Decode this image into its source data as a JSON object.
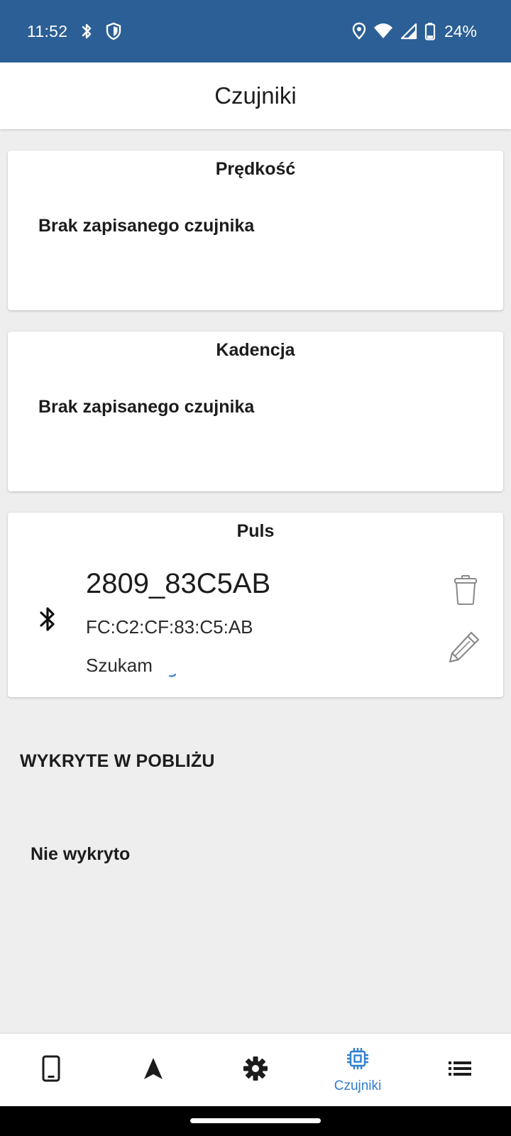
{
  "status_bar": {
    "time": "11:52",
    "battery_text": "24%",
    "icons_left": [
      "bluetooth-icon",
      "shield-icon"
    ],
    "icons_right": [
      "location-icon",
      "wifi-icon",
      "signal-icon",
      "battery-icon"
    ],
    "background": "#2b5f95"
  },
  "app_bar": {
    "title": "Czujniki"
  },
  "sensors": {
    "speed": {
      "title": "Prędkość",
      "empty_text": "Brak zapisanego czujnika"
    },
    "cadence": {
      "title": "Kadencja",
      "empty_text": "Brak zapisanego czujnika"
    },
    "pulse": {
      "title": "Puls",
      "device_name": "2809_83C5AB",
      "mac_address": "FC:C2:CF:83:C5:AB",
      "status": "Szukam",
      "icon": "bluetooth-icon",
      "actions": [
        "trash-icon",
        "pencil-icon"
      ]
    }
  },
  "nearby": {
    "heading": "WYKRYTE W POBLIŻU",
    "empty_text": "Nie wykryto"
  },
  "bottom_nav": {
    "items": [
      {
        "icon": "phone-icon",
        "label": "",
        "active": false
      },
      {
        "icon": "navigation-arrow-icon",
        "label": "",
        "active": false
      },
      {
        "icon": "gear-icon",
        "label": "",
        "active": false
      },
      {
        "icon": "chip-icon",
        "label": "Czujniki",
        "active": true
      },
      {
        "icon": "list-icon",
        "label": "",
        "active": false
      }
    ],
    "active_color": "#2f7fd0"
  }
}
